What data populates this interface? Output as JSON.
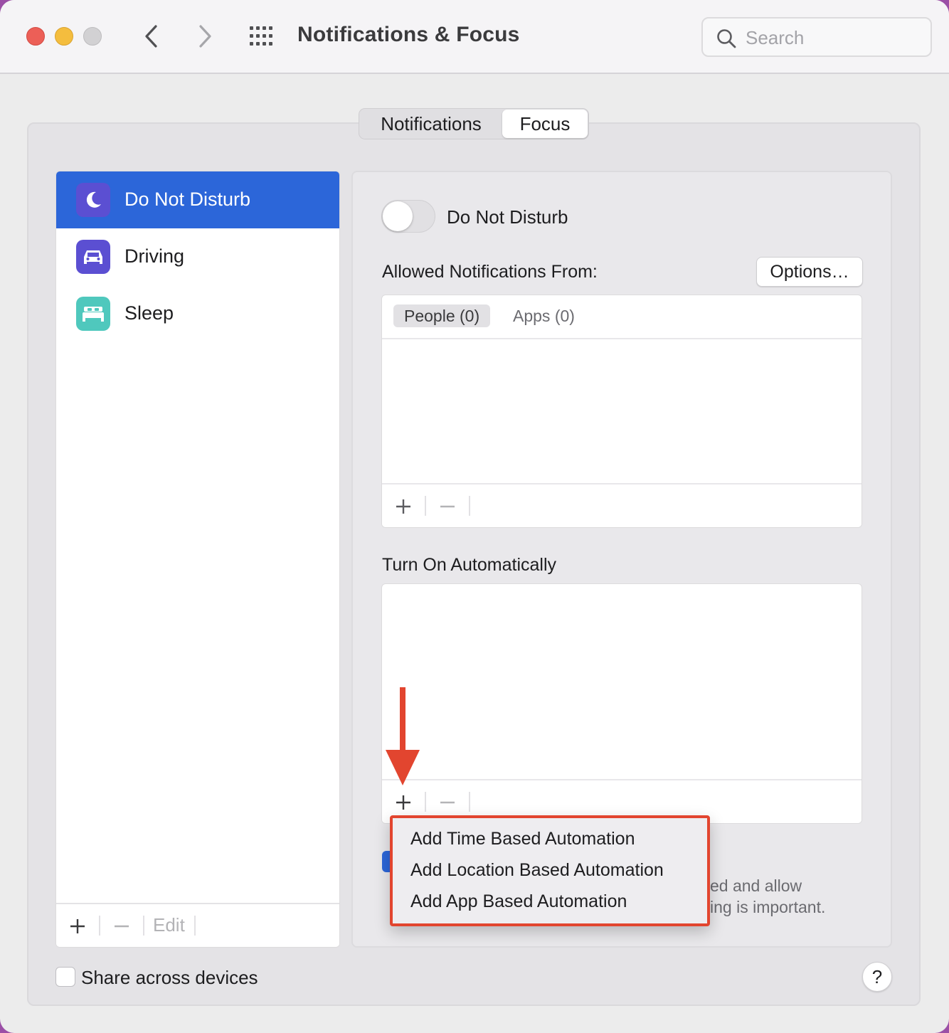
{
  "window": {
    "title": "Notifications & Focus"
  },
  "search": {
    "placeholder": "Search"
  },
  "tabs": {
    "notifications": "Notifications",
    "focus": "Focus",
    "selected": "Focus"
  },
  "sidebar": {
    "items": [
      {
        "label": "Do Not Disturb",
        "icon": "moon-icon",
        "icon_bg": "#5b4fd2",
        "selected": true
      },
      {
        "label": "Driving",
        "icon": "car-icon",
        "icon_bg": "#5b4fd2",
        "selected": false
      },
      {
        "label": "Sleep",
        "icon": "bed-icon",
        "icon_bg": "#4fc8bd",
        "selected": false
      }
    ],
    "add_label": "+",
    "remove_label": "—",
    "edit_label": "Edit"
  },
  "focus_panel": {
    "toggle_label": "Do Not Disturb",
    "toggle_on": false,
    "allowed_label": "Allowed Notifications From:",
    "options_label": "Options…",
    "people_tab": "People (0)",
    "apps_tab": "Apps (0)",
    "add_label": "+",
    "remove_label": "—",
    "auto_label": "Turn On Automatically",
    "description_line1": "ed and allow",
    "description_line2": "ing is important."
  },
  "popup_menu": {
    "items": [
      "Add Time Based Automation",
      "Add Location Based Automation",
      "Add App Based Automation"
    ]
  },
  "footer": {
    "share_label": "Share across devices",
    "share_checked": false,
    "help_label": "?"
  },
  "colors": {
    "accent": "#2c66d9",
    "annotation": "#e2452f"
  }
}
